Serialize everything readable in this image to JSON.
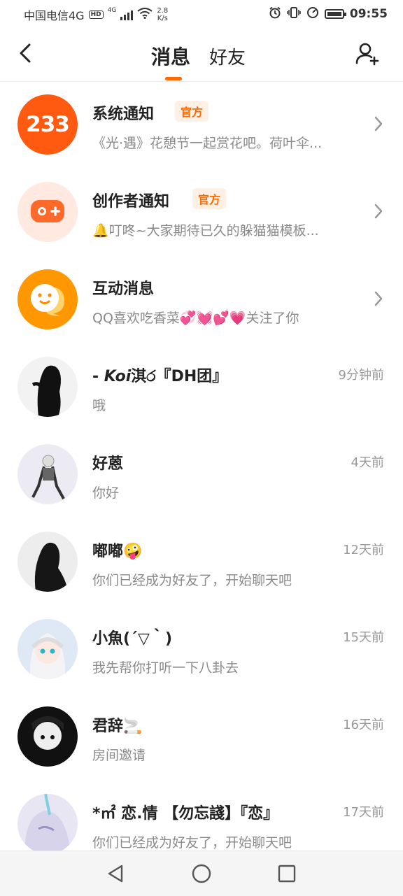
{
  "status_bar": {
    "carrier": "中国电信4G",
    "hd": "HD",
    "net_type": "4G",
    "net_speed_value": "2.8",
    "net_speed_unit": "K/s",
    "time": "09:55"
  },
  "header": {
    "tabs": [
      {
        "label": "消息",
        "active": true
      },
      {
        "label": "好友",
        "active": false
      }
    ],
    "accent_color": "#ff6a00"
  },
  "messages": [
    {
      "name": "系统通知",
      "badge": "官方",
      "preview": "《光·遇》花憩节一起赏花吧。荷叶伞...",
      "avatar_text": "233"
    },
    {
      "name": "创作者通知",
      "badge": "官方",
      "preview": "🔔叮咚~大家期待已久的躲猫猫模板..."
    },
    {
      "name": "互动消息",
      "preview": "QQ喜欢吃香菜💞💓💕💗关注了你"
    },
    {
      "name_prefix": "- ",
      "name_italic": "Koi",
      "name_rest": "淇ර『DH团』",
      "preview": "哦",
      "time": "9分钟前"
    },
    {
      "name": "好蒽",
      "preview": "你好",
      "time": "4天前"
    },
    {
      "name": "嘟嘟🤪",
      "preview": "你们已经成为好友了，开始聊天吧",
      "time": "12天前"
    },
    {
      "name": "小魚(´▽｀)",
      "preview": "我先帮你打听一下八卦去",
      "time": "15天前"
    },
    {
      "name": "君辞🚬",
      "preview": "房间邀请",
      "time": "16天前"
    },
    {
      "name": "*㎡ 恋.情 【勿忘諓】『恋』",
      "preview": "你们已经成为好友了，开始聊天吧",
      "time": "17天前"
    }
  ]
}
